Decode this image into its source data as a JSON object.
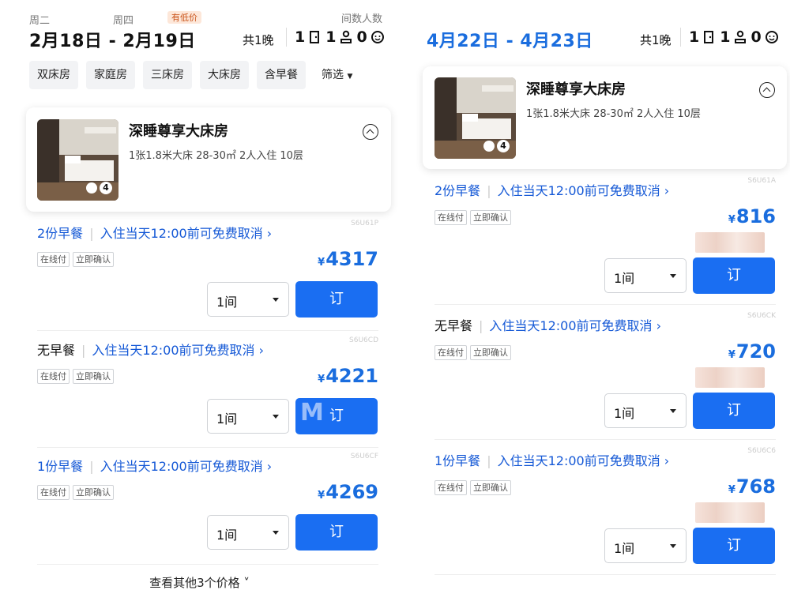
{
  "left": {
    "weekday_in": "周二",
    "weekday_out": "周四",
    "cheap_tag": "有低价",
    "guests_label": "间数人数",
    "dates": "2月18日 - 2月19日",
    "nights": "共1晚",
    "rooms": "1",
    "adults": "1",
    "children": "0",
    "chips": [
      "双床房",
      "家庭房",
      "三床房",
      "大床房",
      "含早餐"
    ],
    "filter_label": "筛选",
    "room": {
      "title": "深睡尊享大床房",
      "spec": "1张1.8米大床 28-30㎡ 2人入住 10层",
      "photo_count": "4"
    },
    "rates": [
      {
        "code": "S6U61P",
        "breakfast": "2份早餐",
        "cancel": "入住当天12:00前可免费取消",
        "tags": [
          "在线付",
          "立即确认"
        ],
        "currency": "¥",
        "price": "4317",
        "qty": "1间",
        "book": "订"
      },
      {
        "code": "S6U6CD",
        "breakfast": "无早餐",
        "cancel": "入住当天12:00前可免费取消",
        "tags": [
          "在线付",
          "立即确认"
        ],
        "currency": "¥",
        "price": "4221",
        "qty": "1间",
        "book": "订"
      },
      {
        "code": "S6U6CF",
        "breakfast": "1份早餐",
        "cancel": "入住当天12:00前可免费取消",
        "tags": [
          "在线付",
          "立即确认"
        ],
        "currency": "¥",
        "price": "4269",
        "qty": "1间",
        "book": "订"
      }
    ],
    "more": "查看其他3个价格",
    "watermark": "M"
  },
  "right": {
    "dates": "4月22日 - 4月23日",
    "nights": "共1晚",
    "rooms": "1",
    "adults": "1",
    "children": "0",
    "room": {
      "title": "深睡尊享大床房",
      "spec": "1张1.8米大床 28-30㎡ 2人入住 10层",
      "photo_count": "4"
    },
    "rates": [
      {
        "code": "S6U61A",
        "breakfast": "2份早餐",
        "cancel": "入住当天12:00前可免费取消",
        "tags": [
          "在线付",
          "立即确认"
        ],
        "currency": "¥",
        "price": "816",
        "qty": "1间",
        "book": "订"
      },
      {
        "code": "S6U6CK",
        "breakfast": "无早餐",
        "cancel": "入住当天12:00前可免费取消",
        "tags": [
          "在线付",
          "立即确认"
        ],
        "currency": "¥",
        "price": "720",
        "qty": "1间",
        "book": "订"
      },
      {
        "code": "S6U6C6",
        "breakfast": "1份早餐",
        "cancel": "入住当天12:00前可免费取消",
        "tags": [
          "在线付",
          "立即确认"
        ],
        "currency": "¥",
        "price": "768",
        "qty": "1间",
        "book": "订"
      }
    ]
  },
  "colors": {
    "accent": "#1a6ef2",
    "price": "#1a6dde",
    "link": "#1458d6"
  },
  "icons": [
    "room-icon",
    "adult-icon",
    "child-icon",
    "collapse-icon",
    "play-icon",
    "dropdown-caret-icon",
    "chevron-right-icon",
    "chevron-down-icon"
  ]
}
